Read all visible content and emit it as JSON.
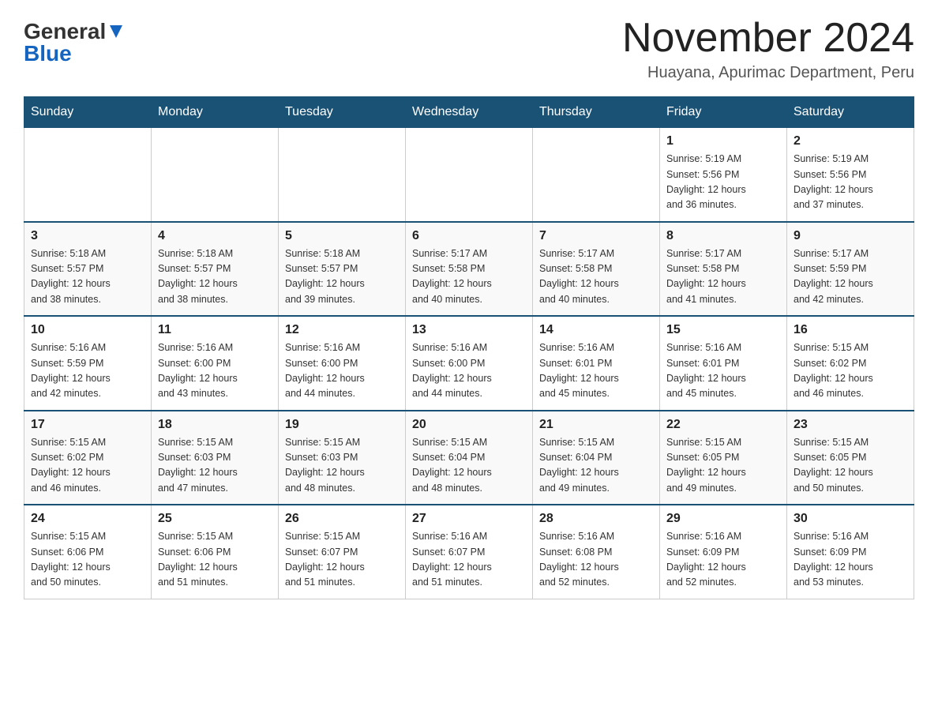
{
  "logo": {
    "general": "General",
    "blue": "Blue"
  },
  "title": "November 2024",
  "location": "Huayana, Apurimac Department, Peru",
  "days_of_week": [
    "Sunday",
    "Monday",
    "Tuesday",
    "Wednesday",
    "Thursday",
    "Friday",
    "Saturday"
  ],
  "weeks": [
    [
      {
        "day": "",
        "info": ""
      },
      {
        "day": "",
        "info": ""
      },
      {
        "day": "",
        "info": ""
      },
      {
        "day": "",
        "info": ""
      },
      {
        "day": "",
        "info": ""
      },
      {
        "day": "1",
        "info": "Sunrise: 5:19 AM\nSunset: 5:56 PM\nDaylight: 12 hours\nand 36 minutes."
      },
      {
        "day": "2",
        "info": "Sunrise: 5:19 AM\nSunset: 5:56 PM\nDaylight: 12 hours\nand 37 minutes."
      }
    ],
    [
      {
        "day": "3",
        "info": "Sunrise: 5:18 AM\nSunset: 5:57 PM\nDaylight: 12 hours\nand 38 minutes."
      },
      {
        "day": "4",
        "info": "Sunrise: 5:18 AM\nSunset: 5:57 PM\nDaylight: 12 hours\nand 38 minutes."
      },
      {
        "day": "5",
        "info": "Sunrise: 5:18 AM\nSunset: 5:57 PM\nDaylight: 12 hours\nand 39 minutes."
      },
      {
        "day": "6",
        "info": "Sunrise: 5:17 AM\nSunset: 5:58 PM\nDaylight: 12 hours\nand 40 minutes."
      },
      {
        "day": "7",
        "info": "Sunrise: 5:17 AM\nSunset: 5:58 PM\nDaylight: 12 hours\nand 40 minutes."
      },
      {
        "day": "8",
        "info": "Sunrise: 5:17 AM\nSunset: 5:58 PM\nDaylight: 12 hours\nand 41 minutes."
      },
      {
        "day": "9",
        "info": "Sunrise: 5:17 AM\nSunset: 5:59 PM\nDaylight: 12 hours\nand 42 minutes."
      }
    ],
    [
      {
        "day": "10",
        "info": "Sunrise: 5:16 AM\nSunset: 5:59 PM\nDaylight: 12 hours\nand 42 minutes."
      },
      {
        "day": "11",
        "info": "Sunrise: 5:16 AM\nSunset: 6:00 PM\nDaylight: 12 hours\nand 43 minutes."
      },
      {
        "day": "12",
        "info": "Sunrise: 5:16 AM\nSunset: 6:00 PM\nDaylight: 12 hours\nand 44 minutes."
      },
      {
        "day": "13",
        "info": "Sunrise: 5:16 AM\nSunset: 6:00 PM\nDaylight: 12 hours\nand 44 minutes."
      },
      {
        "day": "14",
        "info": "Sunrise: 5:16 AM\nSunset: 6:01 PM\nDaylight: 12 hours\nand 45 minutes."
      },
      {
        "day": "15",
        "info": "Sunrise: 5:16 AM\nSunset: 6:01 PM\nDaylight: 12 hours\nand 45 minutes."
      },
      {
        "day": "16",
        "info": "Sunrise: 5:15 AM\nSunset: 6:02 PM\nDaylight: 12 hours\nand 46 minutes."
      }
    ],
    [
      {
        "day": "17",
        "info": "Sunrise: 5:15 AM\nSunset: 6:02 PM\nDaylight: 12 hours\nand 46 minutes."
      },
      {
        "day": "18",
        "info": "Sunrise: 5:15 AM\nSunset: 6:03 PM\nDaylight: 12 hours\nand 47 minutes."
      },
      {
        "day": "19",
        "info": "Sunrise: 5:15 AM\nSunset: 6:03 PM\nDaylight: 12 hours\nand 48 minutes."
      },
      {
        "day": "20",
        "info": "Sunrise: 5:15 AM\nSunset: 6:04 PM\nDaylight: 12 hours\nand 48 minutes."
      },
      {
        "day": "21",
        "info": "Sunrise: 5:15 AM\nSunset: 6:04 PM\nDaylight: 12 hours\nand 49 minutes."
      },
      {
        "day": "22",
        "info": "Sunrise: 5:15 AM\nSunset: 6:05 PM\nDaylight: 12 hours\nand 49 minutes."
      },
      {
        "day": "23",
        "info": "Sunrise: 5:15 AM\nSunset: 6:05 PM\nDaylight: 12 hours\nand 50 minutes."
      }
    ],
    [
      {
        "day": "24",
        "info": "Sunrise: 5:15 AM\nSunset: 6:06 PM\nDaylight: 12 hours\nand 50 minutes."
      },
      {
        "day": "25",
        "info": "Sunrise: 5:15 AM\nSunset: 6:06 PM\nDaylight: 12 hours\nand 51 minutes."
      },
      {
        "day": "26",
        "info": "Sunrise: 5:15 AM\nSunset: 6:07 PM\nDaylight: 12 hours\nand 51 minutes."
      },
      {
        "day": "27",
        "info": "Sunrise: 5:16 AM\nSunset: 6:07 PM\nDaylight: 12 hours\nand 51 minutes."
      },
      {
        "day": "28",
        "info": "Sunrise: 5:16 AM\nSunset: 6:08 PM\nDaylight: 12 hours\nand 52 minutes."
      },
      {
        "day": "29",
        "info": "Sunrise: 5:16 AM\nSunset: 6:09 PM\nDaylight: 12 hours\nand 52 minutes."
      },
      {
        "day": "30",
        "info": "Sunrise: 5:16 AM\nSunset: 6:09 PM\nDaylight: 12 hours\nand 53 minutes."
      }
    ]
  ]
}
